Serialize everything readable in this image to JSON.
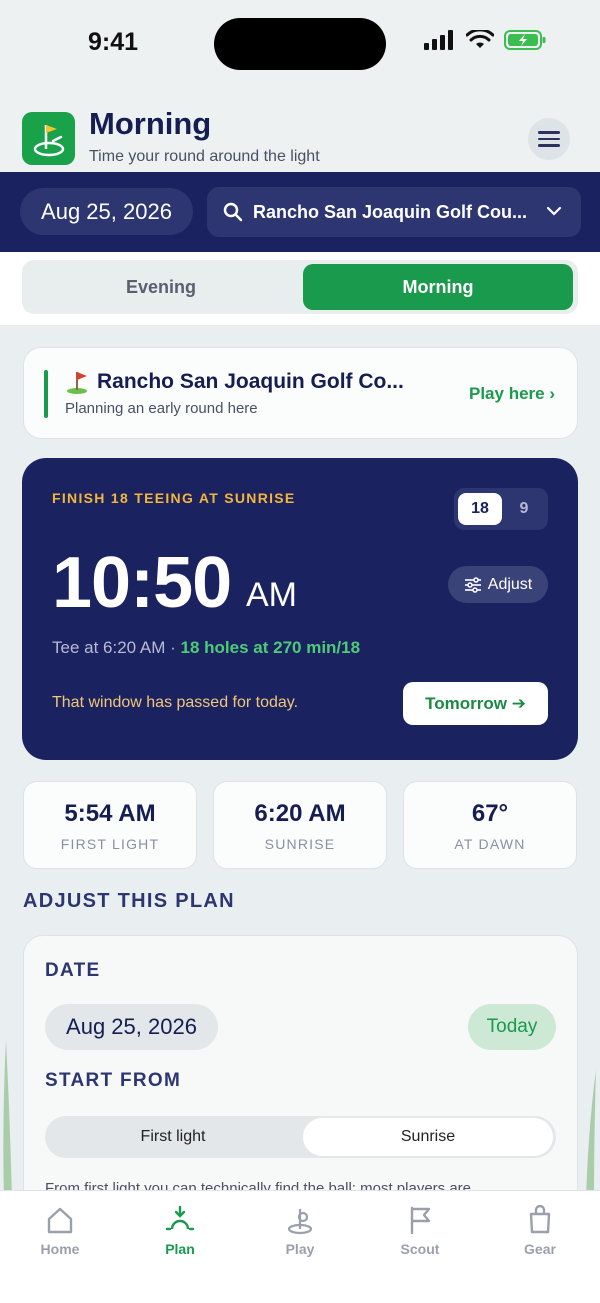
{
  "status_bar": {
    "time": "9:41"
  },
  "header": {
    "title": "Morning",
    "subtitle": "Time your round around the light"
  },
  "nav": {
    "date": "Aug 25, 2026",
    "course": "Rancho San Joaquin Golf Cou..."
  },
  "segments": {
    "evening": "Evening",
    "morning": "Morning",
    "active": "Morning"
  },
  "course_card": {
    "name": "Rancho San Joaquin Golf Co...",
    "subtitle": "Planning an early round here",
    "action": "Play here ›"
  },
  "hero": {
    "label": "FINISH 18 TEEING AT SUNRISE",
    "holes_options": [
      "18",
      "9"
    ],
    "holes_selected": "18",
    "time": "10:50",
    "ampm": "AM",
    "adjust": "Adjust",
    "tee_text": "Tee at 6:20 AM · ",
    "tee_detail": "18 holes at 270 min/18",
    "message": "That window has passed for today.",
    "tomorrow": "Tomorrow ➔"
  },
  "stats": [
    {
      "value": "5:54 AM",
      "label": "FIRST LIGHT"
    },
    {
      "value": "6:20 AM",
      "label": "SUNRISE"
    },
    {
      "value": "67°",
      "label": "AT DAWN"
    }
  ],
  "adjust_section": {
    "title": "ADJUST THIS PLAN",
    "date_label": "DATE",
    "date_value": "Aug 25, 2026",
    "today": "Today",
    "start_label": "START FROM",
    "start_options": [
      "First light",
      "Sunrise"
    ],
    "start_selected": "Sunrise",
    "description": "From first light you can technically find the ball; most players are"
  },
  "tabs": [
    {
      "label": "Home",
      "icon": "home-icon"
    },
    {
      "label": "Plan",
      "icon": "plan-icon",
      "active": true
    },
    {
      "label": "Play",
      "icon": "play-icon"
    },
    {
      "label": "Scout",
      "icon": "scout-icon"
    },
    {
      "label": "Gear",
      "icon": "gear-icon"
    }
  ],
  "colors": {
    "navy": "#1a2260",
    "green": "#1a9a4c",
    "amber": "#f4b63a"
  }
}
